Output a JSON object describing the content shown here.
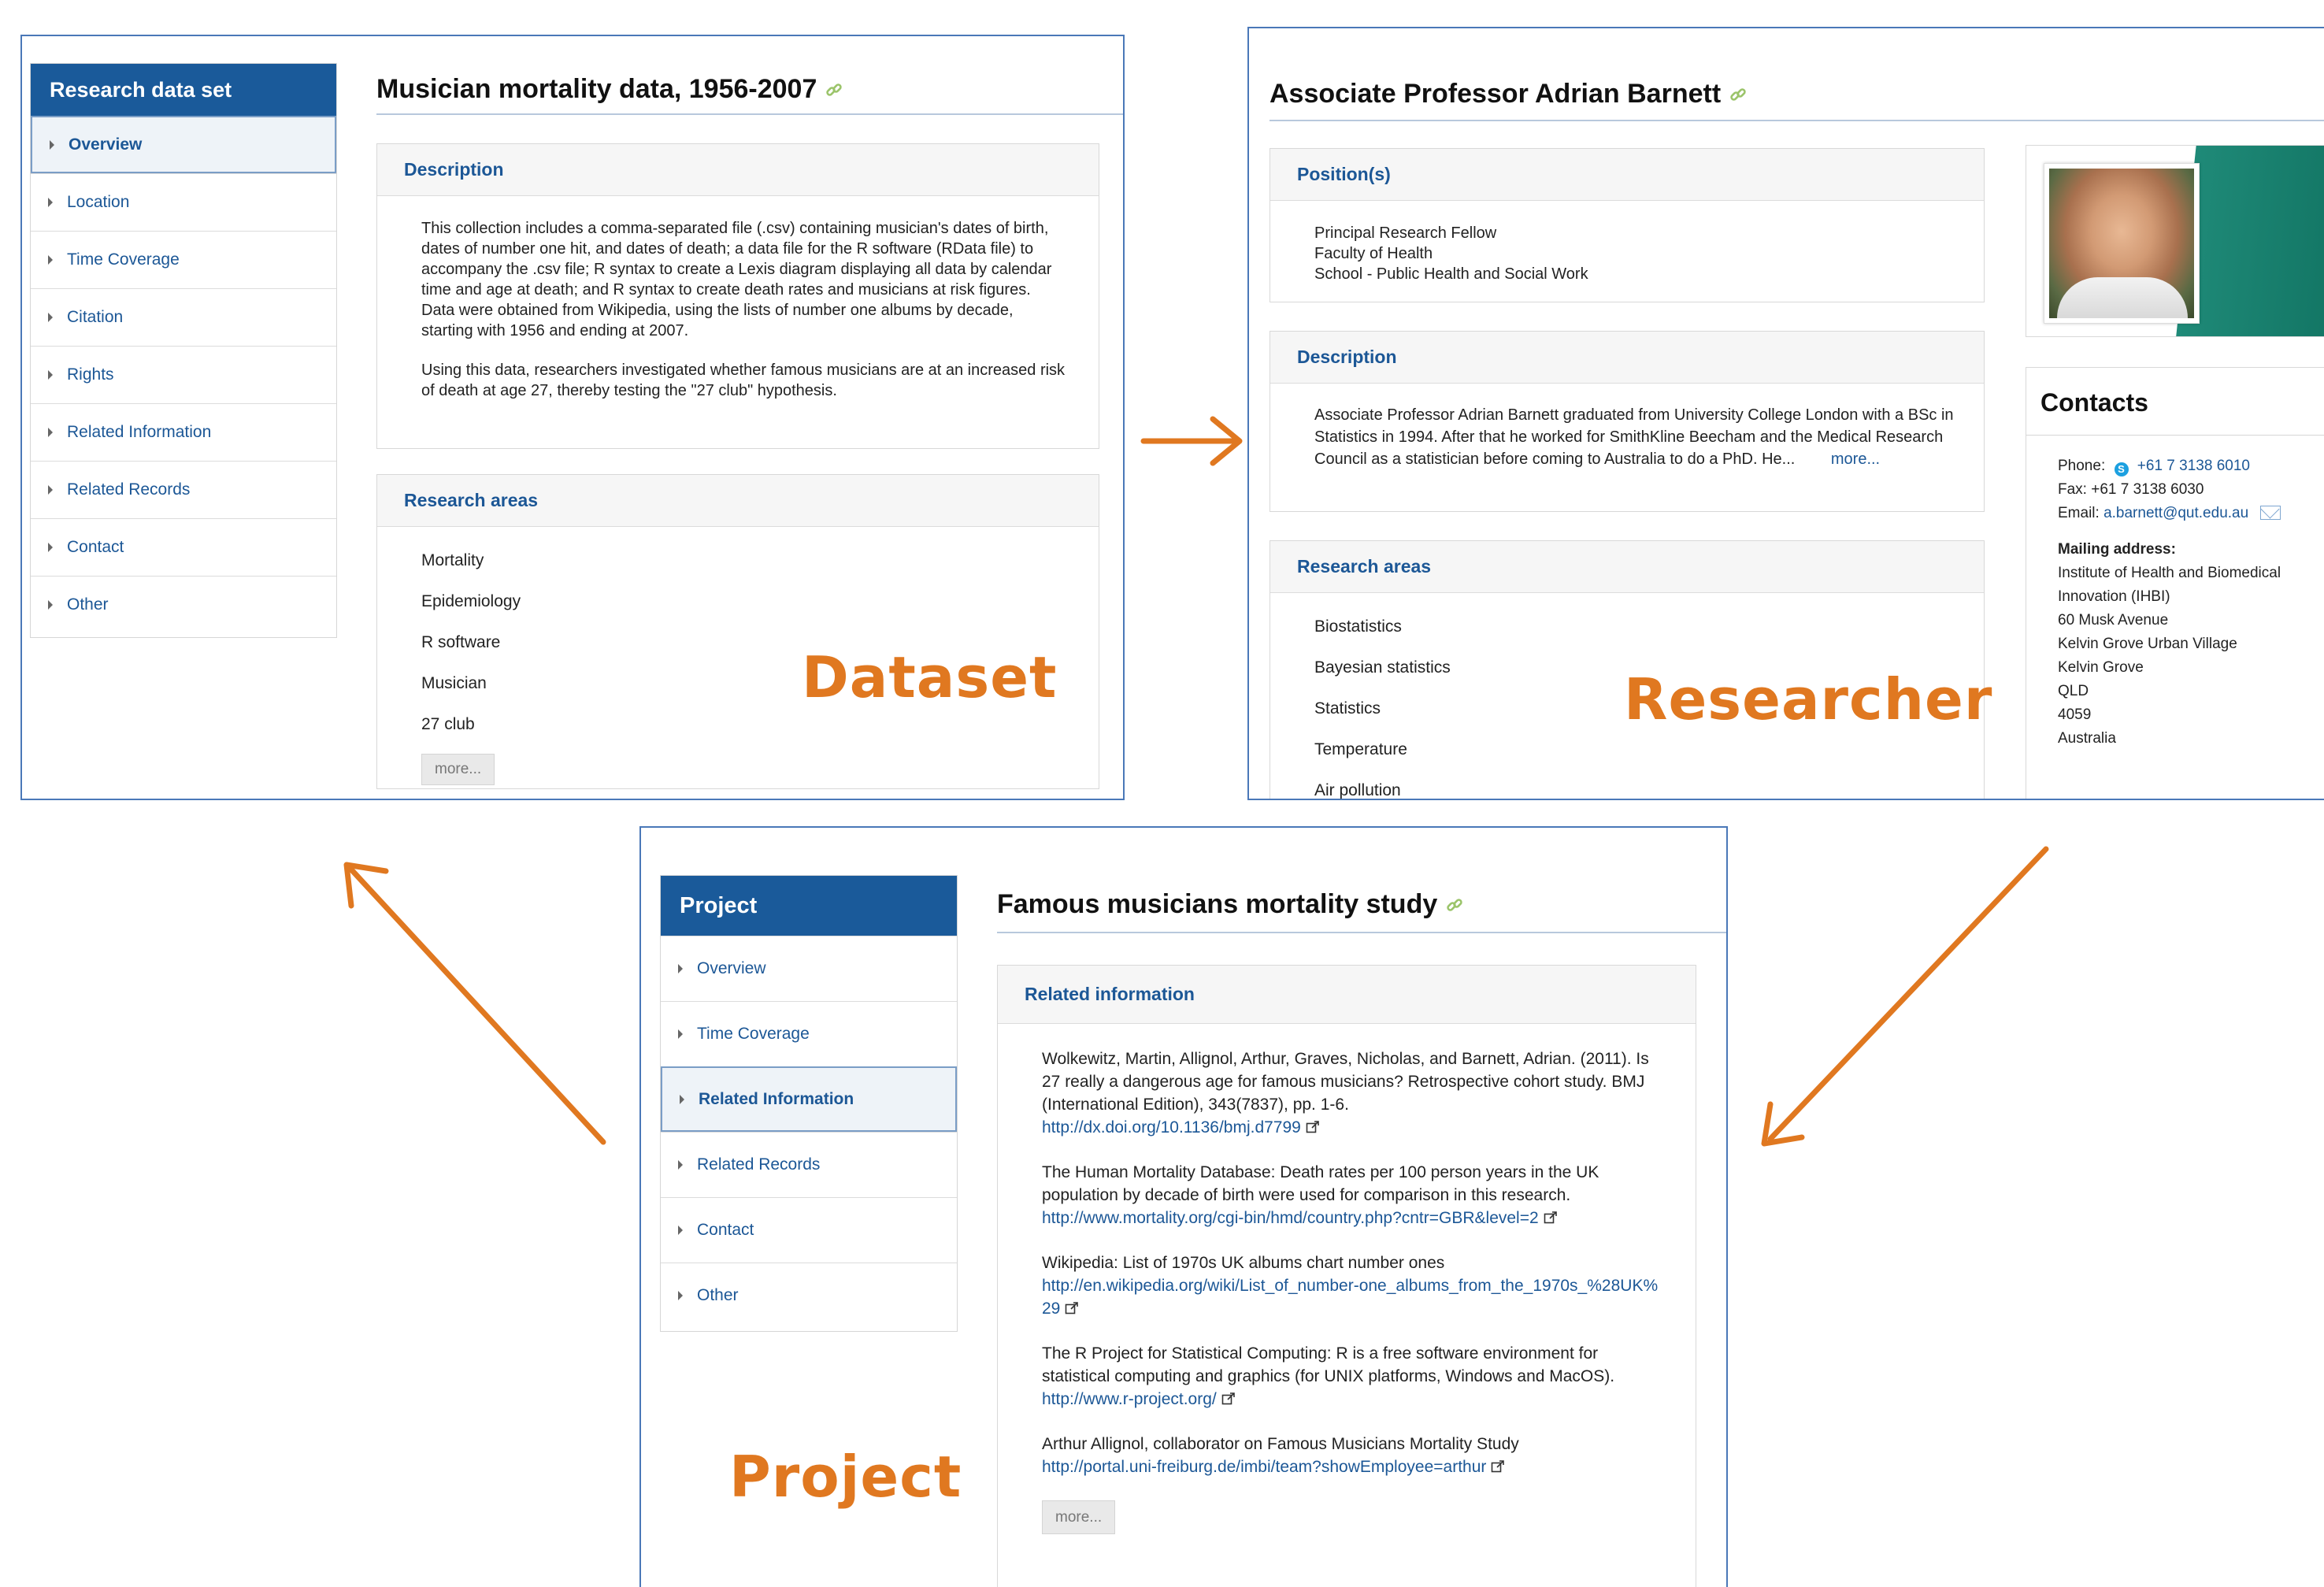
{
  "dataset": {
    "sidebar_title": "Research data set",
    "nav": [
      {
        "label": "Overview",
        "active": true
      },
      {
        "label": "Location"
      },
      {
        "label": "Time Coverage"
      },
      {
        "label": "Citation"
      },
      {
        "label": "Rights"
      },
      {
        "label": "Related Information"
      },
      {
        "label": "Related Records"
      },
      {
        "label": "Contact"
      },
      {
        "label": "Other"
      }
    ],
    "title": "Musician mortality data, 1956-2007",
    "description_heading": "Description",
    "description": [
      "This collection includes a comma-separated file (.csv) containing musician's dates of birth, dates of number one hit, and dates of death; a data file for the R software (RData file) to accompany the .csv file; R syntax to create a Lexis diagram displaying all data by calendar time and age at death; and R syntax to create death rates and musicians at risk figures. Data were obtained from Wikipedia, using the lists of number one albums by decade, starting with 1956 and ending at 2007.",
      "Using this data, researchers investigated whether famous musicians are at an increased risk of death at age 27, thereby testing the \"27 club\" hypothesis."
    ],
    "areas_heading": "Research areas",
    "areas": [
      "Mortality",
      "Epidemiology",
      "R software",
      "Musician",
      "27 club"
    ],
    "more_label": "more...",
    "big_label": "Dataset"
  },
  "researcher": {
    "title": "Associate Professor Adrian Barnett",
    "positions_heading": "Position(s)",
    "positions": [
      "Principal Research Fellow",
      "Faculty of Health",
      "School - Public Health and Social Work"
    ],
    "description_heading": "Description",
    "description": "Associate Professor Adrian Barnett graduated from University College London with a BSc in Statistics in 1994. After that he worked for SmithKline Beecham and the Medical Research Council as a statistician before coming to Australia to do a PhD. He...",
    "description_more": "more...",
    "areas_heading": "Research areas",
    "areas": [
      "Biostatistics",
      "Bayesian statistics",
      "Statistics",
      "Temperature",
      "Air pollution"
    ],
    "contacts": {
      "title": "Contacts",
      "phone_label": "Phone:",
      "phone": "+61 7 3138 6010",
      "fax": "Fax: +61 7 3138 6030",
      "email_label": "Email:",
      "email": "a.barnett@qut.edu.au",
      "mailing_label": "Mailing address:",
      "address": [
        "Institute of Health and Biomedical",
        "Innovation (IHBI)",
        "60 Musk Avenue",
        "Kelvin Grove Urban Village",
        "Kelvin Grove",
        "QLD",
        "4059",
        "Australia"
      ]
    },
    "big_label": "Researcher"
  },
  "project": {
    "sidebar_title": "Project",
    "nav": [
      {
        "label": "Overview"
      },
      {
        "label": "Time Coverage"
      },
      {
        "label": "Related Information",
        "active": true
      },
      {
        "label": "Related Records"
      },
      {
        "label": "Contact"
      },
      {
        "label": "Other"
      }
    ],
    "title": "Famous musicians mortality study",
    "related_heading": "Related information",
    "related": [
      {
        "text": "Wolkewitz, Martin, Allignol, Arthur, Graves, Nicholas, and Barnett, Adrian. (2011). Is 27 really a dangerous age for famous musicians? Retrospective cohort study. BMJ (International Edition), 343(7837), pp. 1-6.",
        "url": "http://dx.doi.org/10.1136/bmj.d7799"
      },
      {
        "text": "The Human Mortality Database: Death rates per 100 person years in the UK population by decade of birth were used for comparison in this research.",
        "url": "http://www.mortality.org/cgi-bin/hmd/country.php?cntr=GBR&level=2"
      },
      {
        "text": "Wikipedia: List of 1970s UK albums chart number ones",
        "url": "http://en.wikipedia.org/wiki/List_of_number-one_albums_from_the_1970s_%28UK%29"
      },
      {
        "text": "The R Project for Statistical Computing: R is a free software environment for statistical computing and graphics (for UNIX platforms, Windows and MacOS).",
        "url": "http://www.r-project.org/"
      },
      {
        "text": "Arthur Allignol, collaborator on Famous Musicians Mortality Study",
        "url": "http://portal.uni-freiburg.de/imbi/team?showEmployee=arthur"
      }
    ],
    "more_label": "more...",
    "big_label": "Project"
  },
  "colors": {
    "accent": "#e07820",
    "nav_blue": "#1a5a9a",
    "link": "#1c5796"
  },
  "icons": [
    "link-chain-icon",
    "external-link-icon",
    "skype-icon",
    "mail-icon",
    "arrow"
  ]
}
